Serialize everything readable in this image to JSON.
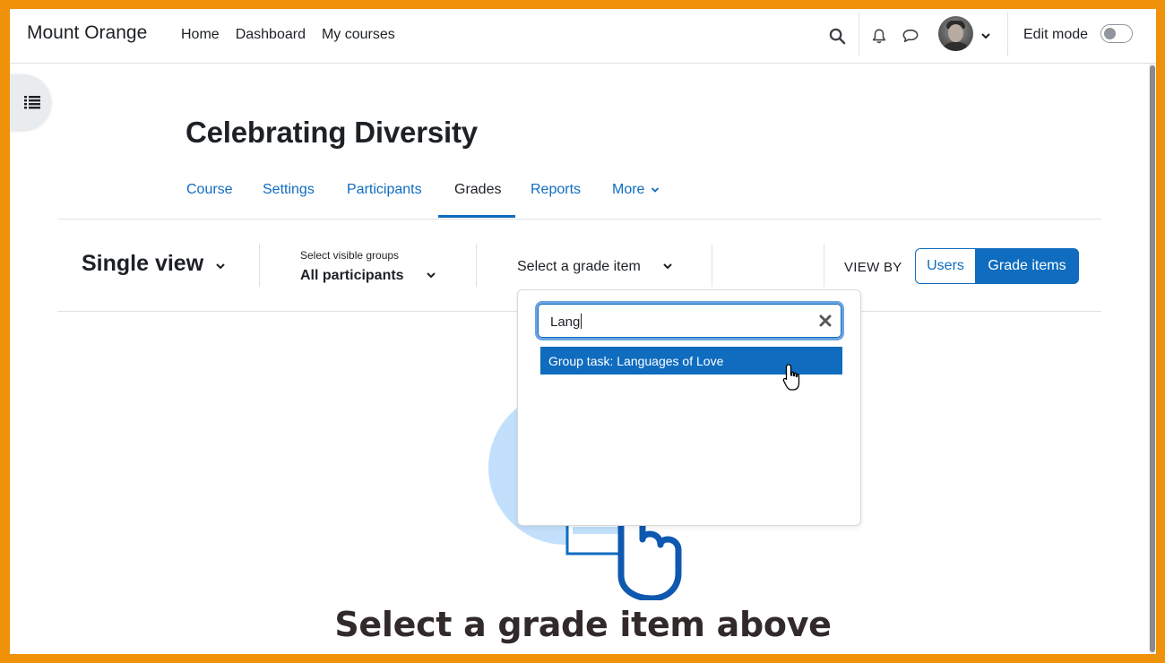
{
  "navbar": {
    "brand": "Mount Orange",
    "links": [
      "Home",
      "Dashboard",
      "My courses"
    ],
    "edit_mode_label": "Edit mode",
    "edit_mode_on": false
  },
  "course": {
    "title": "Celebrating Diversity",
    "tabs": [
      {
        "label": "Course",
        "active": false
      },
      {
        "label": "Settings",
        "active": false
      },
      {
        "label": "Participants",
        "active": false
      },
      {
        "label": "Grades",
        "active": true
      },
      {
        "label": "Reports",
        "active": false
      },
      {
        "label": "More",
        "active": false
      }
    ]
  },
  "grader": {
    "report_name": "Single view",
    "groups_label": "Select visible groups",
    "groups_value": "All participants",
    "grade_item_select": "Select a grade item",
    "view_by_label": "VIEW BY",
    "view_by_users": "Users",
    "view_by_grade_items": "Grade items"
  },
  "dropdown": {
    "search_value": "Lang",
    "results": [
      "Group task: Languages of Love"
    ]
  },
  "empty_state": {
    "title": "Select a grade item above"
  },
  "colors": {
    "primary": "#0f6cbf",
    "outer_border": "#f0910a",
    "illustration_circle": "#c2e0fb"
  }
}
